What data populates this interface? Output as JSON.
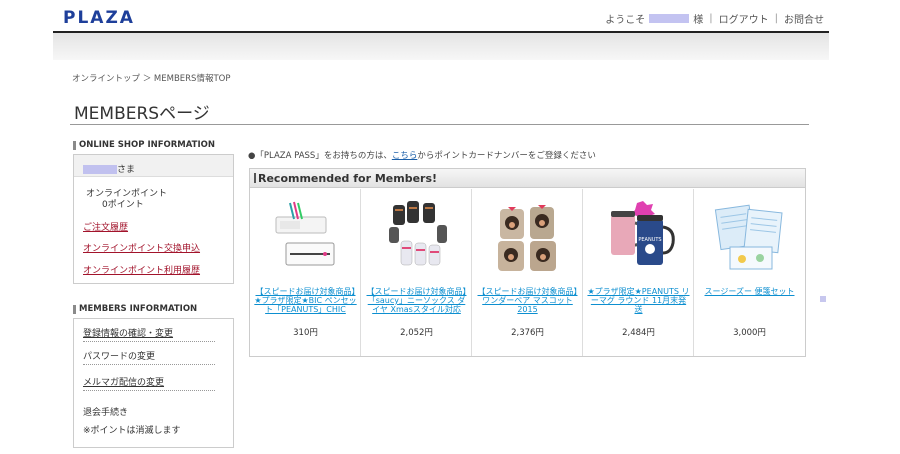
{
  "header": {
    "logo": "PLAZA",
    "welcome": "ようこそ",
    "sama": "様",
    "logout": "ログアウト",
    "contact": "お問合せ"
  },
  "breadcrumb": "オンライントップ ＞ MEMBERS情報TOP",
  "page_title": "MEMBERSページ",
  "sidebar": {
    "shop_heading": "ONLINE SHOP INFORMATION",
    "greeting_suffix": "さま",
    "points_label": "オンラインポイント",
    "points_value": "0ポイント",
    "links": [
      "ご注文履歴",
      "オンラインポイント交換申込",
      "オンラインポイント利用履歴"
    ],
    "members_heading": "MEMBERS INFORMATION",
    "members_items": [
      "登録情報の確認・変更",
      "パスワードの変更",
      "メルマガ配信の変更",
      "退会手続き",
      "※ポイントは消滅します"
    ]
  },
  "main": {
    "notice_prefix": "●「PLAZA PASS」をお持ちの方は、",
    "notice_link": "こちら",
    "notice_suffix": "からポイントカードナンバーをご登録ください",
    "recommend_title": "Recommended for Members!",
    "products": [
      {
        "name": "【スピードお届け対象商品】★プラザ限定★BIC ペンセット「PEANUTS」CHIC",
        "price": "310円",
        "icon": "pen-set-image"
      },
      {
        "name": "【スピードお届け対象商品】「saucy」ニーソックス ダイヤ Xmasスタイル対応",
        "price": "2,052円",
        "icon": "gloves-image"
      },
      {
        "name": "【スピードお届け対象商品】ワンダーベア マスコット 2015",
        "price": "2,376円",
        "icon": "mascot-bags-image"
      },
      {
        "name": "★プラザ限定★PEANUTS リーマグ ラウンド 11月末発送",
        "price": "2,484円",
        "icon": "mug-image"
      },
      {
        "name": "スージーズー 便箋セット",
        "price": "3,000円",
        "icon": "stationery-image"
      }
    ]
  },
  "colors": {
    "logo": "#1e3f9a",
    "side_link": "#a2132b",
    "product_link": "#0d8fd0"
  }
}
